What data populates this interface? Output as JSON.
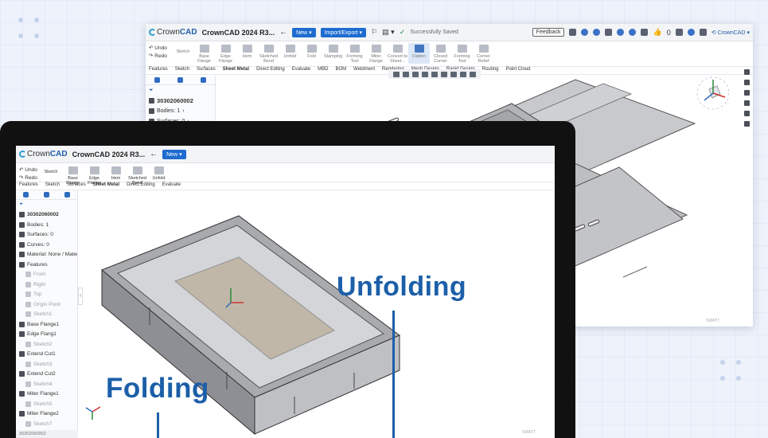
{
  "back_window": {
    "logo": {
      "crown": "Crown",
      "cad": "CAD"
    },
    "title": "CrownCAD 2024 R3...",
    "new_label": "New",
    "import_export_label": "Import/Export",
    "save_status": "Successfully Saved",
    "feedback_label": "Feedback",
    "likes_count": "0",
    "right_brand": "CrownCAD",
    "undo_label": "Undo",
    "redo_label": "Redo",
    "sketch_label": "Sketch",
    "ribbon": [
      "Base Flange",
      "Edge Flange",
      "Hem",
      "Sketched Bend",
      "Unfold",
      "Fold",
      "Stamping",
      "Forming Tool",
      "Miter Flange",
      "Convert to Sheet...",
      "Flatten",
      "Closed Corner",
      "Forming Tool",
      "Corner Relief"
    ],
    "active_ribbon": "Flatten",
    "tabs": [
      "Features",
      "Sketch",
      "Surfaces",
      "Sheet Metal",
      "Direct Editing",
      "Evaluate",
      "MBD",
      "BOM",
      "Weldment",
      "Rendering",
      "Mesh Design",
      "Rapid Design",
      "Routing",
      "Point Cloud"
    ],
    "active_tab": "Sheet Metal",
    "tree_root": "30302060002",
    "tree": [
      "Bodies: 1",
      "Surfaces: 0",
      "Curves: 0",
      "Material: None / Material Ni",
      "Features"
    ],
    "status": "30302060002",
    "corner_text": "SWATT"
  },
  "front_window": {
    "logo": {
      "crown": "Crown",
      "cad": "CAD"
    },
    "title": "CrownCAD 2024 R3...",
    "new_label": "New",
    "undo_label": "Undo",
    "redo_label": "Redo",
    "sketch_label": "Sketch",
    "ribbon": [
      "Base Flange",
      "Edge Flange",
      "Hem",
      "Sketched Bend",
      "Unfold"
    ],
    "tabs": [
      "Features",
      "Sketch",
      "Surfaces",
      "Sheet Metal",
      "Direct Editing",
      "Evaluate"
    ],
    "active_tab": "Sheet Metal",
    "tree_root": "30302060002",
    "tree": [
      {
        "label": "Bodies: 1",
        "sub": false
      },
      {
        "label": "Surfaces: 0",
        "sub": false
      },
      {
        "label": "Curves: 0",
        "sub": false
      },
      {
        "label": "Material: None / Material Ni",
        "sub": false
      },
      {
        "label": "Features",
        "sub": false
      },
      {
        "label": "Front",
        "sub": true
      },
      {
        "label": "Right",
        "sub": true
      },
      {
        "label": "Top",
        "sub": true
      },
      {
        "label": "Origin Point",
        "sub": true
      },
      {
        "label": "Sketch1",
        "sub": true
      },
      {
        "label": "Base Flange1",
        "sub": false
      },
      {
        "label": "Edge Flang1",
        "sub": false
      },
      {
        "label": "Sketch2",
        "sub": true
      },
      {
        "label": "Extend Cut1",
        "sub": false
      },
      {
        "label": "Sketch3",
        "sub": true
      },
      {
        "label": "Extend Cut2",
        "sub": false
      },
      {
        "label": "Sketch4",
        "sub": true
      },
      {
        "label": "Miter Flange1",
        "sub": false
      },
      {
        "label": "Sketch5",
        "sub": true
      },
      {
        "label": "Miter Flange2",
        "sub": false
      },
      {
        "label": "Sketch7",
        "sub": true
      }
    ],
    "status": "30302060002",
    "corner_text": "SWATT"
  },
  "overlay_tree": [
    {
      "label": "Features",
      "sub": false
    },
    {
      "label": "Front",
      "sub": true
    },
    {
      "label": "Right",
      "sub": true
    },
    {
      "label": "Top",
      "sub": true
    },
    {
      "label": "Origin Point",
      "sub": true
    },
    {
      "label": "Sketch1",
      "sub": true
    },
    {
      "label": "Base Flange1",
      "sub": false
    },
    {
      "label": "Edge Flang1",
      "sub": false
    },
    {
      "label": "Sketch2",
      "sub": true
    },
    {
      "label": "Extend Cut1",
      "sub": false
    },
    {
      "label": "Sketch3",
      "sub": true
    },
    {
      "label": "Extend Cut2",
      "sub": false
    },
    {
      "label": "Sketch4",
      "sub": true
    },
    {
      "label": "Miter Flange1",
      "sub": false
    },
    {
      "label": "Sketch5",
      "sub": true
    },
    {
      "label": "Miter Flange2",
      "sub": false
    },
    {
      "label": "Sketch6",
      "sub": true
    }
  ],
  "captions": {
    "unfolding": "Unfolding",
    "folding": "Folding"
  },
  "colors": {
    "accent": "#1c5fa8",
    "button": "#1e6cd0"
  }
}
